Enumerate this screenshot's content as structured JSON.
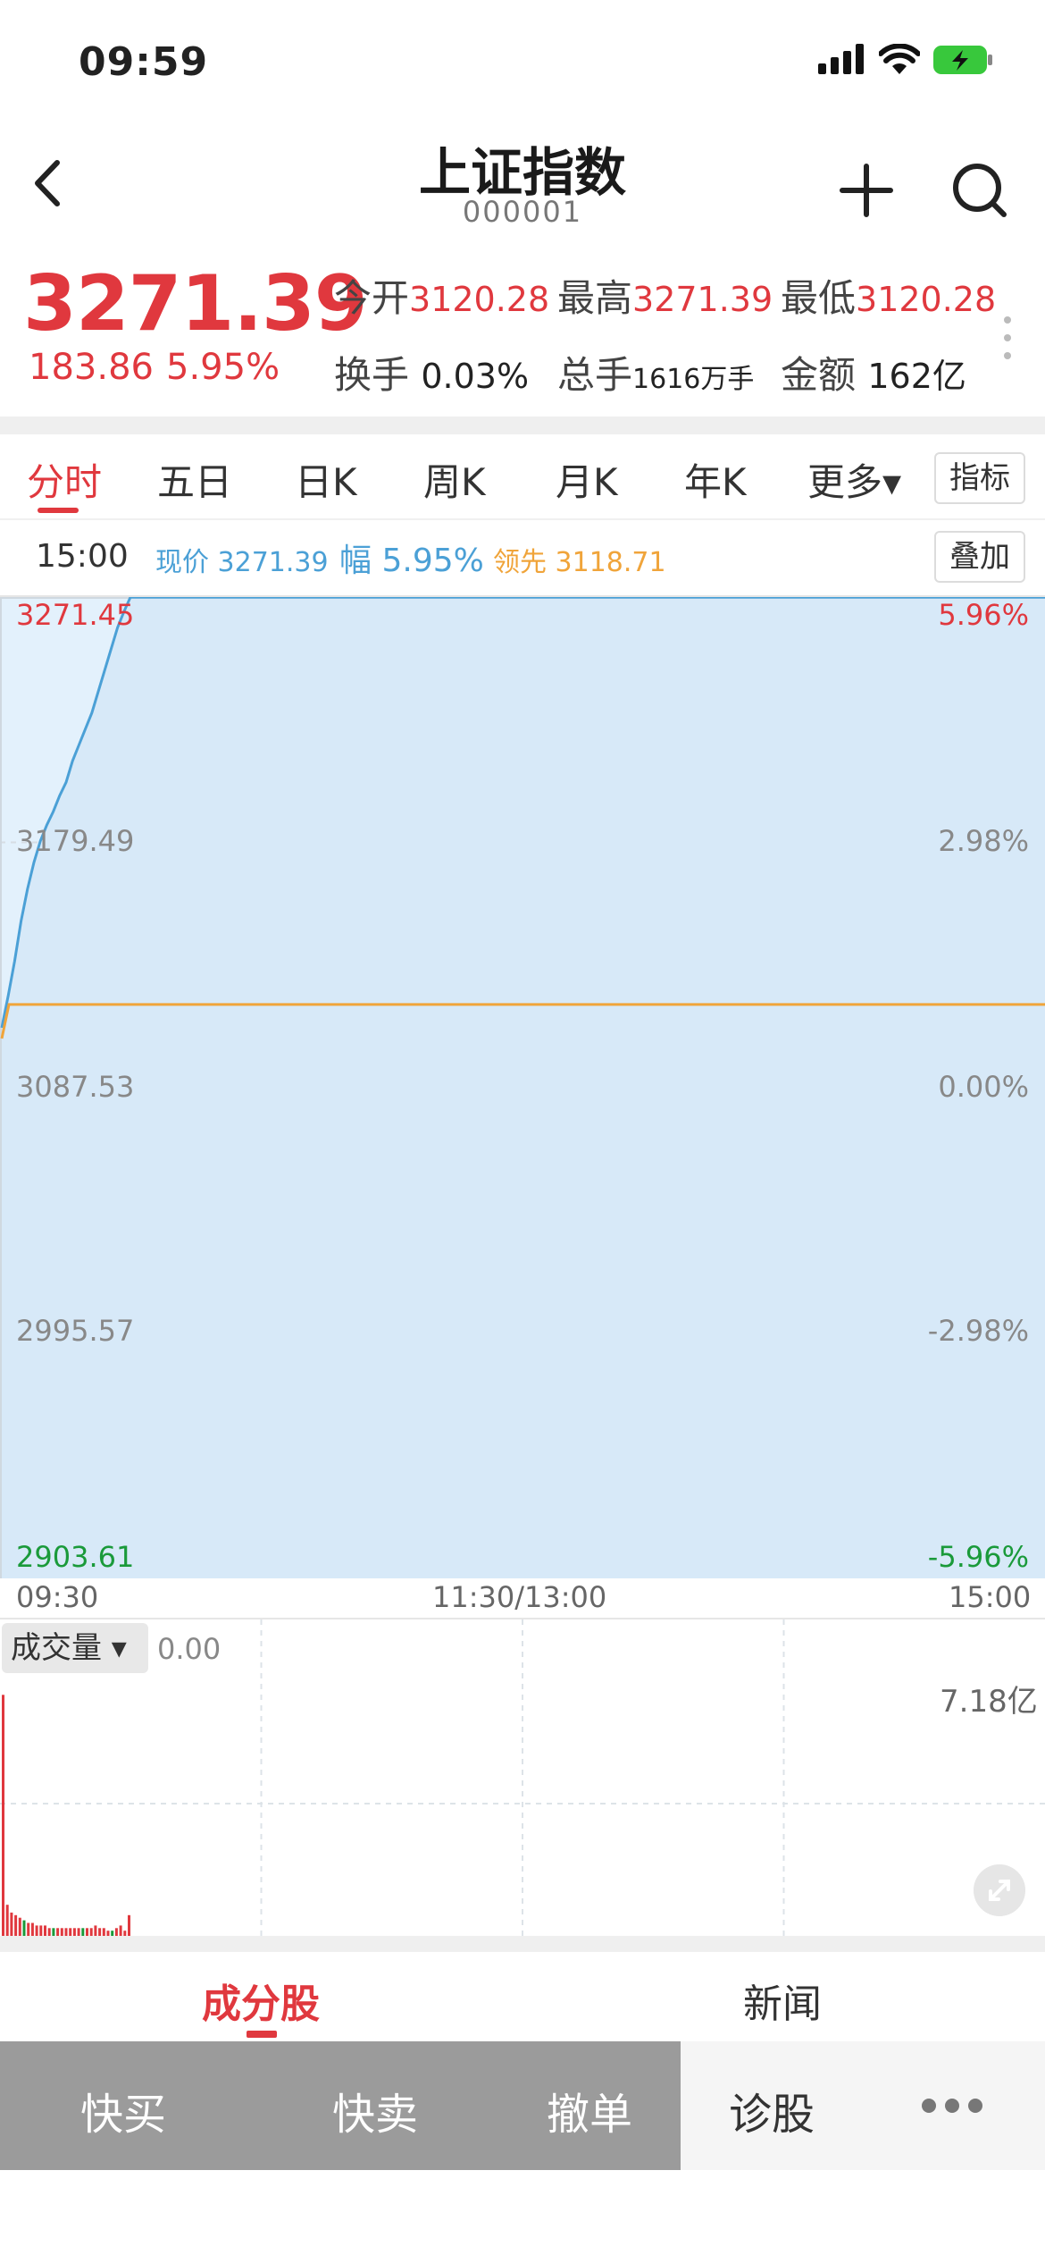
{
  "status": {
    "time": "09:59"
  },
  "nav": {
    "title": "上证指数",
    "code": "000001"
  },
  "quote": {
    "price": "3271.39",
    "change": "183.86",
    "change_pct": "5.95%",
    "open_label": "今开",
    "open_value": "3120.28",
    "high_label": "最高",
    "high_value": "3271.39",
    "low_label": "最低",
    "low_value": "3120.28",
    "turnover_label": "换手",
    "turnover_value": "0.03%",
    "volume_label": "总手",
    "volume_value": "1616万手",
    "amount_label": "金额",
    "amount_value": "162亿"
  },
  "tabs": {
    "items": [
      "分时",
      "五日",
      "日K",
      "周K",
      "月K",
      "年K",
      "更多▾"
    ],
    "indicator_button": "指标"
  },
  "info_row": {
    "time": "15:00",
    "price_label": "现价",
    "price_value": "3271.39",
    "amp_label": "幅",
    "amp_value": "5.95%",
    "lead_label": "领先",
    "lead_value": "3118.71",
    "overlay_button": "叠加"
  },
  "chart_data": {
    "type": "line",
    "y_left_ticks": [
      "3271.45",
      "3179.49",
      "3087.53",
      "2995.57",
      "2903.61"
    ],
    "y_right_ticks": [
      "5.96%",
      "2.98%",
      "0.00%",
      "-2.98%",
      "-5.96%"
    ],
    "x_ticks": [
      "09:30",
      "11:30/13:00",
      "15:00"
    ],
    "ylim": [
      2903.61,
      3271.45
    ],
    "prev_close": 3087.53,
    "series": [
      {
        "values": [
          3110,
          3122,
          3135,
          3150,
          3162,
          3172,
          3180,
          3186,
          3191,
          3197,
          3202,
          3210,
          3216,
          3222,
          3228,
          3236,
          3244,
          3252,
          3260,
          3266,
          3271.39
        ],
        "color": "#4ba0d6"
      },
      {
        "values": [
          3106,
          3118.71
        ],
        "color": "#f0a43a"
      }
    ],
    "colors": {
      "up": "#e0383e",
      "down": "#1a9a3a",
      "price_line": "#4ba0d6",
      "lead_line": "#f0a43a",
      "fill": "#e3f1fc"
    }
  },
  "volume": {
    "selector": "成交量 ▾",
    "zero": "0.00",
    "max": "7.18亿",
    "bars": [
      0.93,
      0.12,
      0.09,
      0.08,
      0.07,
      0.06,
      0.05,
      0.05,
      0.04,
      0.04,
      0.04,
      0.03,
      0.03,
      0.03,
      0.03,
      0.03,
      0.03,
      0.03,
      0.03,
      0.03,
      0.03,
      0.03,
      0.04,
      0.03,
      0.03,
      0.02,
      0.02,
      0.03,
      0.04,
      0.02,
      0.08
    ]
  },
  "bottom_tabs": {
    "items": [
      "成分股",
      "新闻"
    ]
  },
  "actions": {
    "quick_buy": "快买",
    "quick_sell": "快卖",
    "cancel": "撤单",
    "diagnose": "诊股"
  }
}
